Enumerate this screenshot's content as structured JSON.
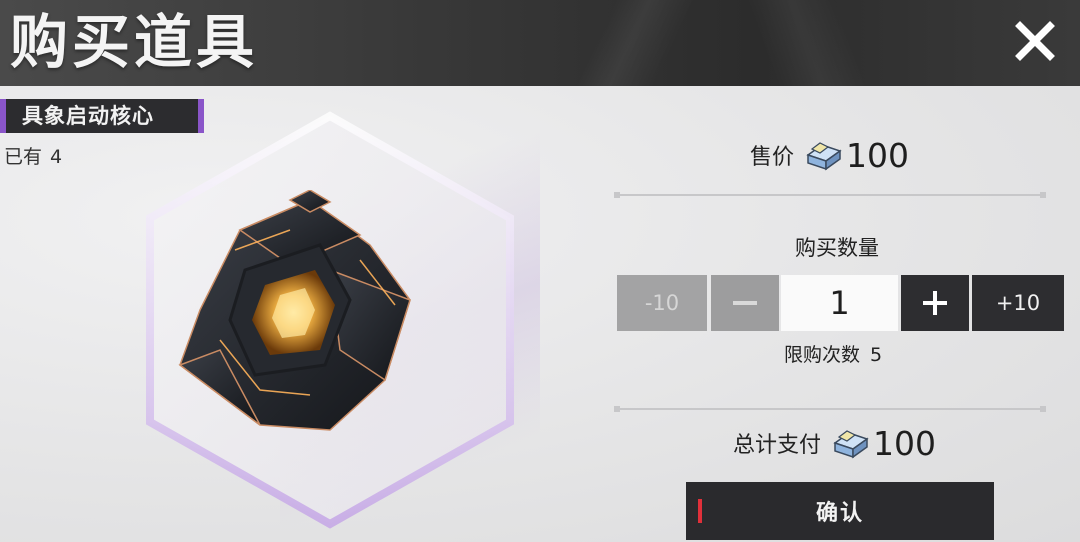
{
  "header": {
    "title": "购买道具",
    "close_icon": "close-icon"
  },
  "item": {
    "name": "具象启动核心",
    "owned_label": "已有",
    "owned_count": "4",
    "image_icon": "activation-core-cube"
  },
  "price": {
    "label": "售价",
    "currency_icon": "crystal-currency-icon",
    "value": "100"
  },
  "quantity": {
    "label": "购买数量",
    "minus10_label": "-10",
    "minus_icon": "minus-icon",
    "value": "1",
    "plus_icon": "plus-icon",
    "plus10_label": "+10",
    "limit_label": "限购次数",
    "limit_value": "5"
  },
  "total": {
    "label": "总计支付",
    "currency_icon": "crystal-currency-icon",
    "value": "100"
  },
  "confirm": {
    "label": "确认"
  },
  "colors": {
    "header_bg": "#333333",
    "accent_purple": "#8a55c9",
    "confirm_accent_red": "#e0303a",
    "button_dark": "#2d2d30",
    "button_disabled": "#a3a3a4"
  }
}
